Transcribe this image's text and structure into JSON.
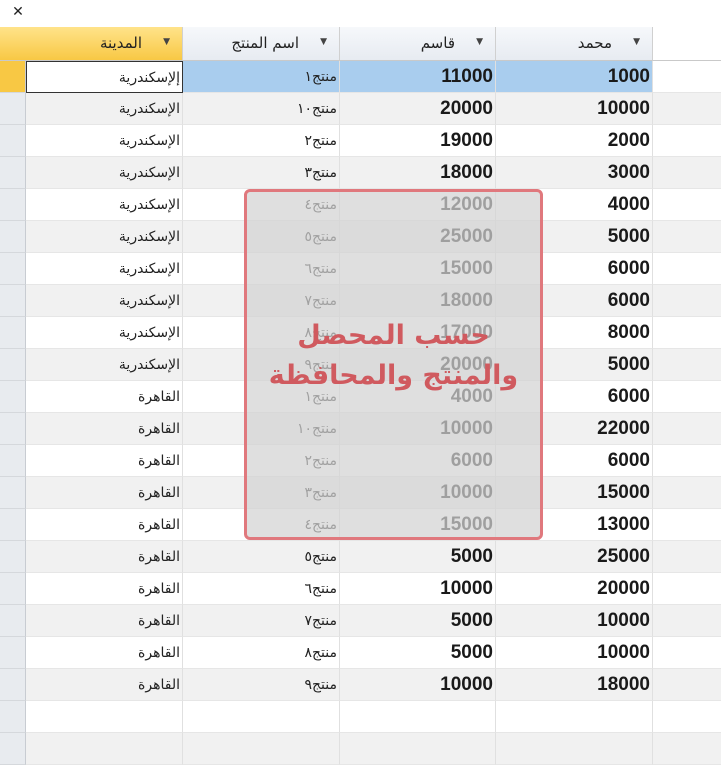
{
  "window": {
    "close_glyph": "✕",
    "close_icon": "close-icon"
  },
  "columns": {
    "city": "المدينة",
    "product": "اسم المنتج",
    "qasem": "قاسم",
    "mohamed": "محمد",
    "sort_glyph": "▼"
  },
  "rows": [
    {
      "city": "إلإسكندرية",
      "product": "منتج١",
      "qasem": "11000",
      "mohamed": "1000"
    },
    {
      "city": "الإسكندرية",
      "product": "منتج١٠",
      "qasem": "20000",
      "mohamed": "10000"
    },
    {
      "city": "الإسكندرية",
      "product": "منتج٢",
      "qasem": "19000",
      "mohamed": "2000"
    },
    {
      "city": "الإسكندرية",
      "product": "منتج٣",
      "qasem": "18000",
      "mohamed": "3000"
    },
    {
      "city": "الإسكندرية",
      "product": "منتج٤",
      "qasem": "12000",
      "mohamed": "4000"
    },
    {
      "city": "الإسكندرية",
      "product": "منتج٥",
      "qasem": "25000",
      "mohamed": "5000"
    },
    {
      "city": "الإسكندرية",
      "product": "منتج٦",
      "qasem": "15000",
      "mohamed": "6000"
    },
    {
      "city": "الإسكندرية",
      "product": "منتج٧",
      "qasem": "18000",
      "mohamed": "6000"
    },
    {
      "city": "الإسكندرية",
      "product": "منتج٨",
      "qasem": "17000",
      "mohamed": "8000"
    },
    {
      "city": "الإسكندرية",
      "product": "منتج٩",
      "qasem": "20000",
      "mohamed": "5000"
    },
    {
      "city": "القاهرة",
      "product": "منتج١",
      "qasem": "4000",
      "mohamed": "6000"
    },
    {
      "city": "القاهرة",
      "product": "منتج١٠",
      "qasem": "10000",
      "mohamed": "22000"
    },
    {
      "city": "القاهرة",
      "product": "منتج٢",
      "qasem": "6000",
      "mohamed": "6000"
    },
    {
      "city": "القاهرة",
      "product": "منتج٣",
      "qasem": "10000",
      "mohamed": "15000"
    },
    {
      "city": "القاهرة",
      "product": "منتج٤",
      "qasem": "15000",
      "mohamed": "13000"
    },
    {
      "city": "القاهرة",
      "product": "منتج٥",
      "qasem": "5000",
      "mohamed": "25000"
    },
    {
      "city": "القاهرة",
      "product": "منتج٦",
      "qasem": "10000",
      "mohamed": "20000"
    },
    {
      "city": "القاهرة",
      "product": "منتج٧",
      "qasem": "5000",
      "mohamed": "10000"
    },
    {
      "city": "القاهرة",
      "product": "منتج٨",
      "qasem": "5000",
      "mohamed": "10000"
    },
    {
      "city": "القاهرة",
      "product": "منتج٩",
      "qasem": "10000",
      "mohamed": "18000"
    }
  ],
  "overlay": {
    "line1": "حسب المحصل",
    "line2": "والمنتج والمحافظة"
  },
  "colors": {
    "selected_row_highlight": "#a9cdee",
    "header_selected": "#f8c844",
    "overlay_border": "#e0787d",
    "overlay_text": "#d05a5f"
  }
}
